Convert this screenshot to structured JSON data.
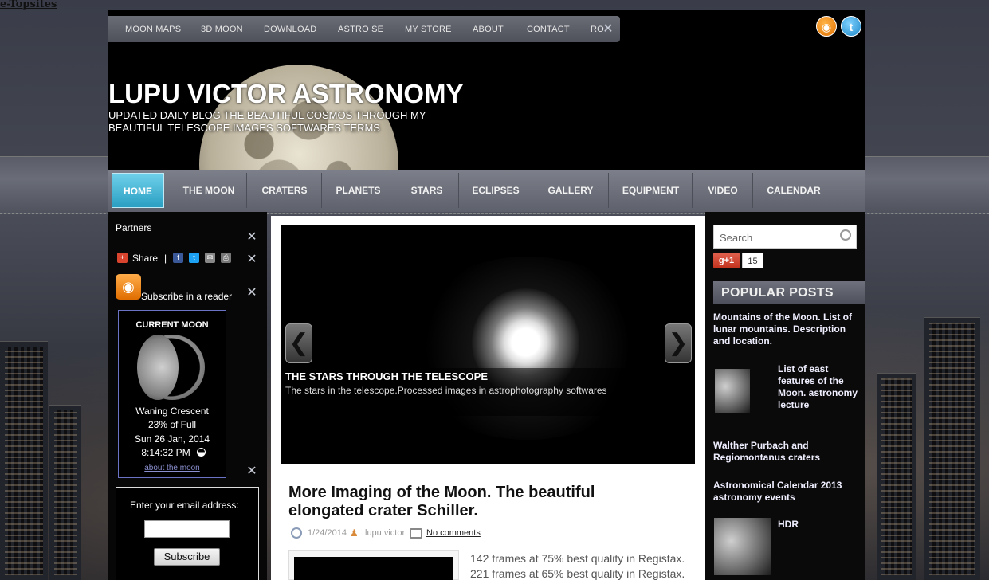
{
  "watermark": "e-Topsites",
  "header": {
    "title": "LUPU VICTOR ASTRONOMY",
    "subtitle": "UPDATED DAILY BLOG THE BEAUTIFUL COSMOS THROUGH MY BEAUTIFUL TELESCOPE.IMAGES SOFTWARES TERMS",
    "top_nav": [
      "MOON MAPS",
      "3D MOON",
      "DOWNLOAD",
      "ASTRO SE",
      "MY STORE",
      "ABOUT",
      "CONTACT",
      "RO"
    ],
    "social": {
      "rss": "rss-icon",
      "twitter": "twitter-icon"
    }
  },
  "main_nav": [
    "HOME",
    "THE MOON",
    "CRATERS",
    "PLANETS",
    "STARS",
    "ECLIPSES",
    "GALLERY",
    "EQUIPMENT",
    "VIDEO",
    "CALENDAR"
  ],
  "left": {
    "partners": "Partners",
    "share": "Share",
    "separator": "|",
    "subscribe_reader": "Subscribe in a reader",
    "moon": {
      "heading": "CURRENT MOON",
      "phase": "Waning Crescent",
      "percent": "23% of Full",
      "date": "Sun 26 Jan, 2014",
      "time": "8:14:32 PM",
      "link": "about the moon"
    },
    "email_label": "Enter your email address:",
    "email_value": "",
    "subscribe_button": "Subscribe"
  },
  "slider": {
    "title": "THE STARS THROUGH THE TELESCOPE",
    "text": "The stars in the telescope.Processed images in astrophotography softwares",
    "prev": "❮",
    "next": "❯"
  },
  "post": {
    "title": "More Imaging of the Moon. The beautiful elongated crater Schiller.",
    "date": "1/24/2014",
    "author": "lupu victor",
    "comments": "No comments",
    "lines": [
      "142 frames at 75% best quality in Registax.",
      "221 frames at 65% best quality in Registax."
    ]
  },
  "right": {
    "search_placeholder": "Search",
    "gplus_label": "g+1",
    "gplus_count": "15",
    "popular_heading": "POPULAR POSTS",
    "popular": [
      "Mountains of the Moon. List of lunar mountains. Description and location.",
      "List of east features of the Moon. astronomy lecture",
      "Walther Purbach and Regiomontanus craters",
      "Astronomical Calendar 2013 astronomy events",
      "HDR"
    ]
  },
  "colors": {
    "active_nav": "#2a9fc2",
    "link_text": "#eeeeff",
    "background": "#3b3e4a"
  }
}
